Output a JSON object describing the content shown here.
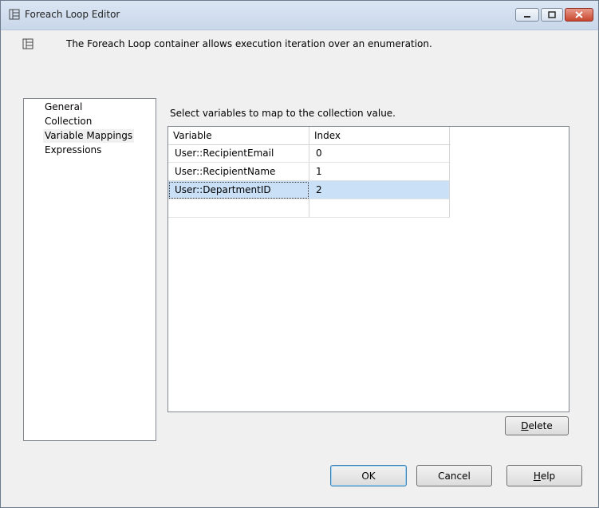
{
  "window": {
    "title": "Foreach Loop Editor"
  },
  "header": {
    "description": "The Foreach Loop container allows execution iteration over an enumeration."
  },
  "nav": {
    "items": [
      {
        "label": "General"
      },
      {
        "label": "Collection"
      },
      {
        "label": "Variable Mappings",
        "selected": true
      },
      {
        "label": "Expressions"
      }
    ]
  },
  "main": {
    "instruction": "Select variables to map to the collection value.",
    "columns": {
      "variable": "Variable",
      "index": "Index"
    },
    "rows": [
      {
        "variable": "User::RecipientEmail",
        "index": "0"
      },
      {
        "variable": "User::RecipientName",
        "index": "1"
      },
      {
        "variable": "User::DepartmentID",
        "index": "2",
        "selected": true
      },
      {
        "variable": "",
        "index": ""
      }
    ],
    "delete_button": {
      "label_rest": "elete",
      "mnemonic": "D"
    }
  },
  "footer": {
    "ok": "OK",
    "cancel": "Cancel",
    "help": {
      "mnemonic": "H",
      "label_rest": "elp"
    }
  },
  "colors": {
    "selection": "#c9e0f7",
    "titlebar": "#dbe6f3",
    "close_button": "#c8462f"
  }
}
